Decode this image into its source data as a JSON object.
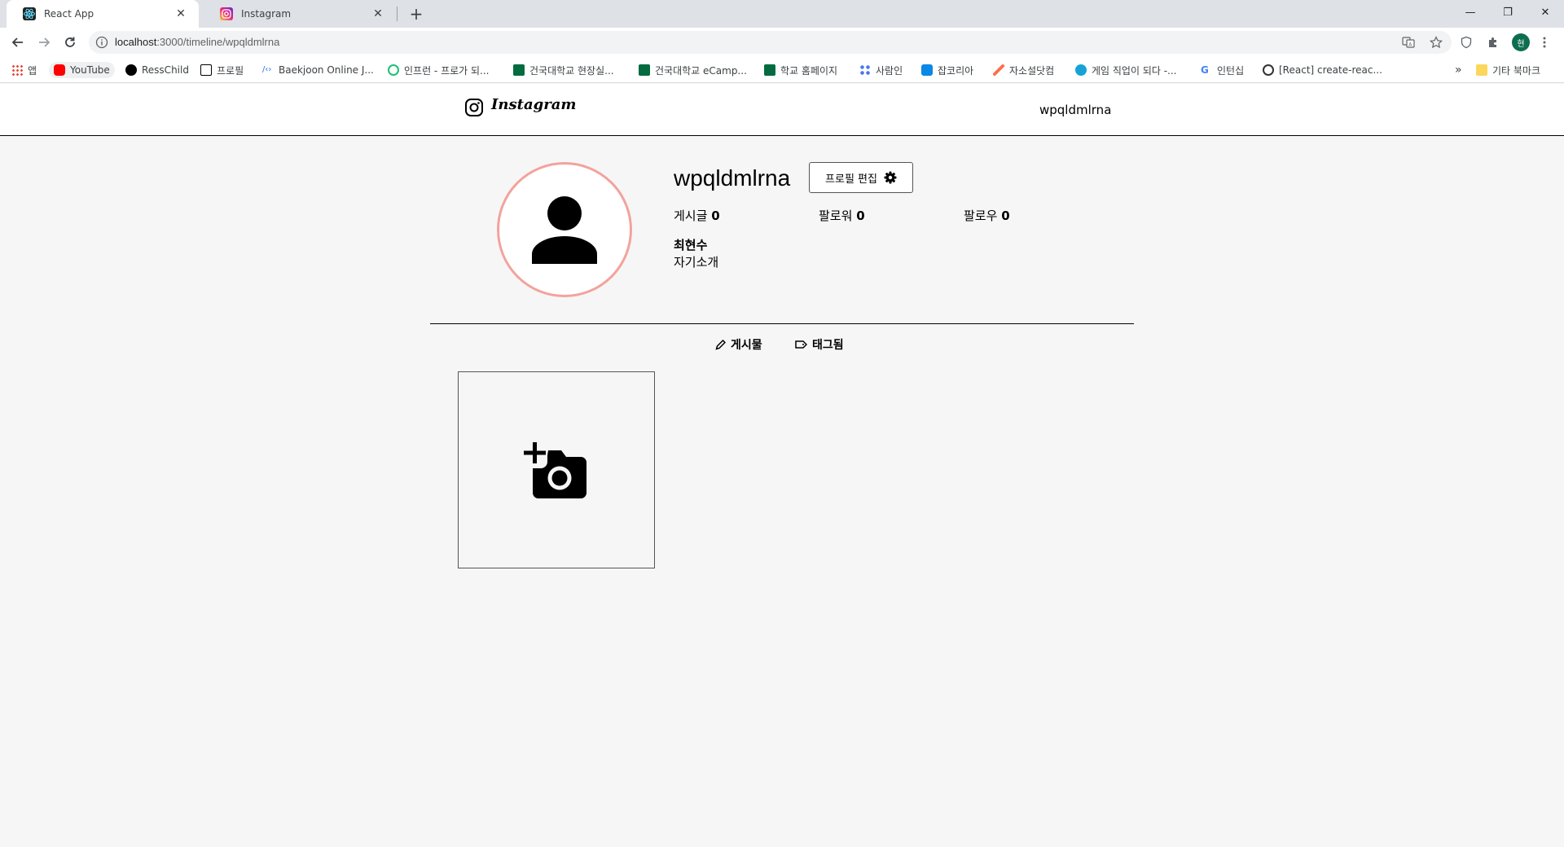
{
  "browser": {
    "tabs": [
      {
        "title": "React App",
        "active": true
      },
      {
        "title": "Instagram",
        "active": false
      }
    ],
    "url_host": "localhost",
    "url_path": ":3000/timeline/wpqldmlrna",
    "profile_initial": "현",
    "bookmarks": [
      {
        "label": "앱",
        "icon": "apps-grid-icon"
      },
      {
        "label": "YouTube",
        "icon": "youtube-icon",
        "color": "#ff0000"
      },
      {
        "label": "RessChild",
        "icon": "github-icon",
        "color": "#000000"
      },
      {
        "label": "프로필",
        "icon": "notion-icon",
        "color": "#000000"
      },
      {
        "label": "Baekjoon Online J...",
        "icon": "code-icon",
        "color": "#1a73e8"
      },
      {
        "label": "인프런 - 프로가 되...",
        "icon": "inflearn-icon",
        "color": "#1dc078"
      },
      {
        "label": "건국대학교 현장실...",
        "icon": "ku-icon",
        "color": "#036b3f"
      },
      {
        "label": "건국대학교 eCamp...",
        "icon": "ku-icon",
        "color": "#036b3f"
      },
      {
        "label": "학교 홈페이지",
        "icon": "ku-icon",
        "color": "#036b3f"
      },
      {
        "label": "사람인",
        "icon": "saramin-icon",
        "color": "#4876ef"
      },
      {
        "label": "잡코리아",
        "icon": "jobkorea-icon",
        "color": "#0a88e6"
      },
      {
        "label": "자소설닷컴",
        "icon": "pen-icon",
        "color": "#ff6f4d"
      },
      {
        "label": "게임 직업이 되다 -...",
        "icon": "game-icon",
        "color": "#17a2d6"
      },
      {
        "label": "인턴십",
        "icon": "google-icon",
        "color": "#4285f4"
      },
      {
        "label": "[React] create-reac...",
        "icon": "react-icon",
        "color": "#333333"
      }
    ],
    "overflow": "»",
    "other_bookmarks": "기타 북마크"
  },
  "header": {
    "logo_text": "Instagram",
    "username": "wpqldmlrna"
  },
  "profile": {
    "username": "wpqldmlrna",
    "edit_button": "프로필 편집",
    "stats": [
      {
        "label": "게시글",
        "value": "0"
      },
      {
        "label": "팔로워",
        "value": "0"
      },
      {
        "label": "팔로우",
        "value": "0"
      }
    ],
    "name": "최현수",
    "bio": "자기소개"
  },
  "tabs": {
    "posts": "게시물",
    "tagged": "태그됨"
  },
  "colors": {
    "avatar_ring": "#f2a39c",
    "page_bg": "#f6f6f6"
  }
}
